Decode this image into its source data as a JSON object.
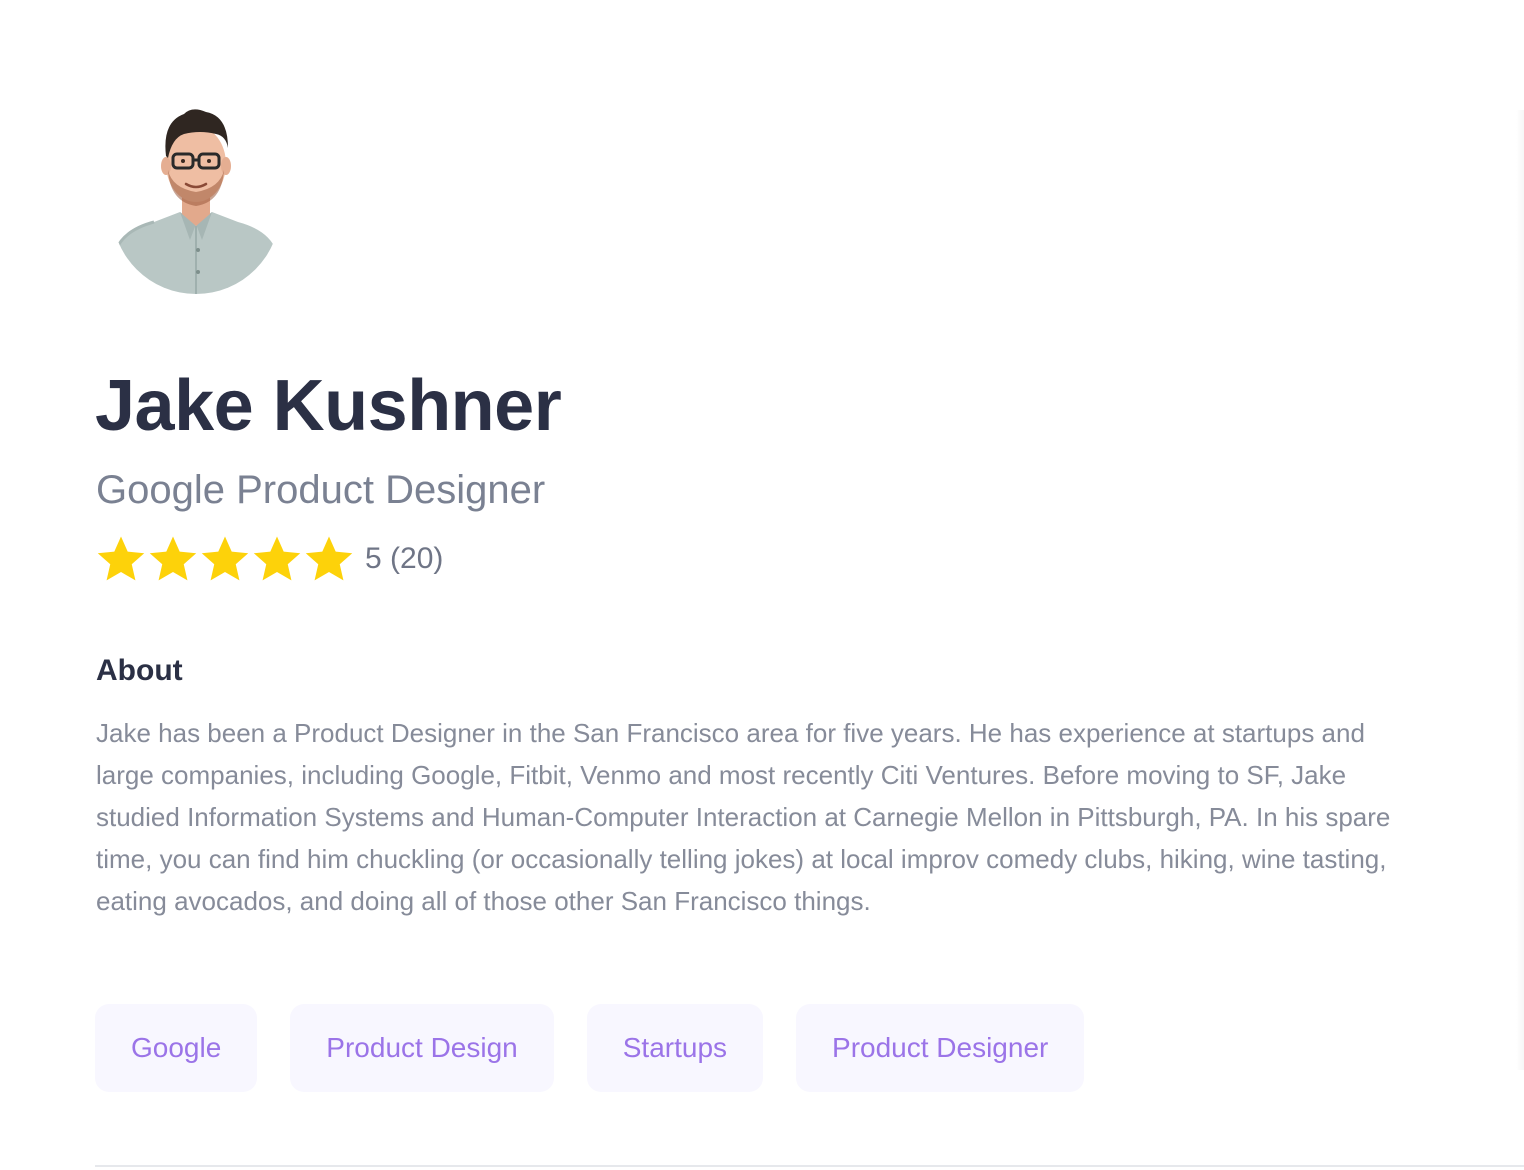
{
  "profile": {
    "name": "Jake Kushner",
    "headline": "Google Product Designer",
    "rating": {
      "stars": 5,
      "max_stars": 5,
      "summary": "5 (20)",
      "star_color": "#fdd20a"
    }
  },
  "about": {
    "heading": "About",
    "body": "Jake has been a Product Designer in the San Francisco area for five years. He has experience at startups and large companies, including Google, Fitbit, Venmo and most recently Citi Ventures. Before moving to SF, Jake studied Information Systems and Human-Computer Interaction at Carnegie Mellon in Pittsburgh, PA. In his spare time, you can find him chuckling (or occasionally telling jokes) at local improv comedy clubs, hiking, wine tasting, eating avocados, and doing all of those other San Francisco things."
  },
  "tags": [
    {
      "label": "Google"
    },
    {
      "label": "Product Design"
    },
    {
      "label": "Startups"
    },
    {
      "label": "Product Designer"
    }
  ],
  "colors": {
    "text_primary": "#2b3045",
    "text_secondary": "#7a8192",
    "tag_bg": "#f8f7ff",
    "tag_text": "#9b74e8"
  }
}
